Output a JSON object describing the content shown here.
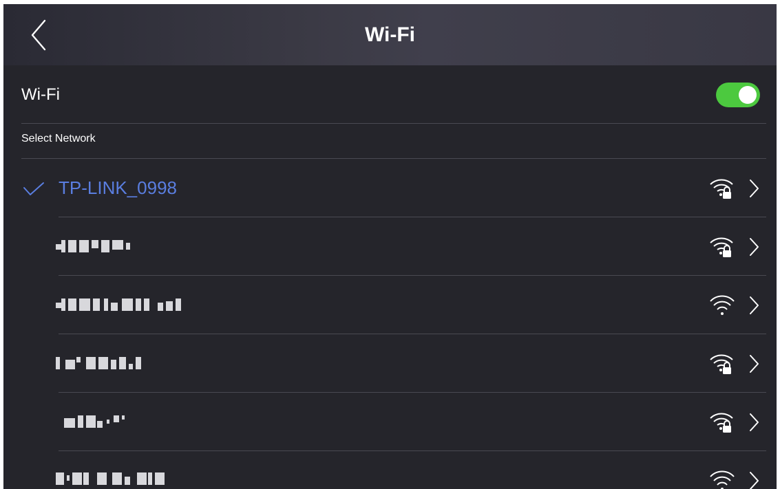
{
  "header": {
    "title": "Wi-Fi",
    "back_icon": "chevron-left-icon"
  },
  "wifi_toggle": {
    "label": "Wi-Fi",
    "enabled": true,
    "on_color": "#4cc93f"
  },
  "section": {
    "label": "Select Network"
  },
  "colors": {
    "background": "#25252b",
    "connected_text": "#5a7ee0",
    "text": "#ffffff",
    "divider": "#4a4a52"
  },
  "networks": [
    {
      "name": "TP-LINK_0998",
      "connected": true,
      "secured": true,
      "signal_icon": "wifi-lock-icon",
      "chevron_icon": "chevron-right-icon"
    },
    {
      "name": "",
      "redacted": true,
      "secured": true,
      "signal_icon": "wifi-lock-icon",
      "chevron_icon": "chevron-right-icon"
    },
    {
      "name": "",
      "redacted": true,
      "secured": false,
      "signal_icon": "wifi-icon",
      "chevron_icon": "chevron-right-icon"
    },
    {
      "name": "",
      "redacted": true,
      "secured": true,
      "signal_icon": "wifi-lock-icon",
      "chevron_icon": "chevron-right-icon"
    },
    {
      "name": "",
      "redacted": true,
      "secured": true,
      "signal_icon": "wifi-lock-icon",
      "chevron_icon": "chevron-right-icon"
    },
    {
      "name": "",
      "redacted": true,
      "secured": false,
      "signal_icon": "wifi-icon",
      "chevron_icon": "chevron-right-icon"
    }
  ]
}
